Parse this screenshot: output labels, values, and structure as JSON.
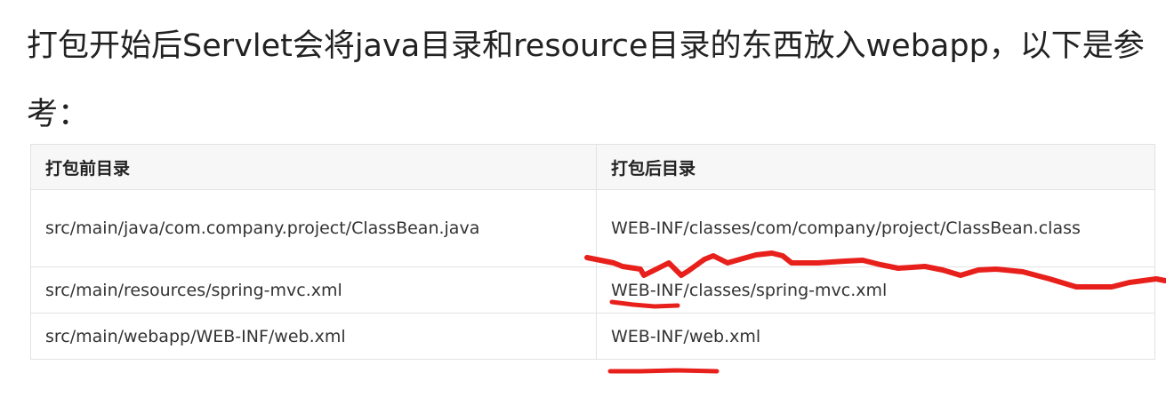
{
  "paragraph": "打包开始后Servlet会将java目录和resource目录的东西放入webapp，以下是参考：",
  "table": {
    "headers": [
      "打包前目录",
      "打包后目录"
    ],
    "rows": [
      [
        "src/main/java/com.company.project/ClassBean.java",
        "WEB-INF/classes/com/company/project/ClassBean.class"
      ],
      [
        "src/main/resources/spring-mvc.xml",
        "WEB-INF/classes/spring-mvc.xml"
      ],
      [
        "src/main/webapp/WEB-INF/web.xml",
        "WEB-INF/web.xml"
      ]
    ]
  },
  "annotation_color": "#e8201c"
}
